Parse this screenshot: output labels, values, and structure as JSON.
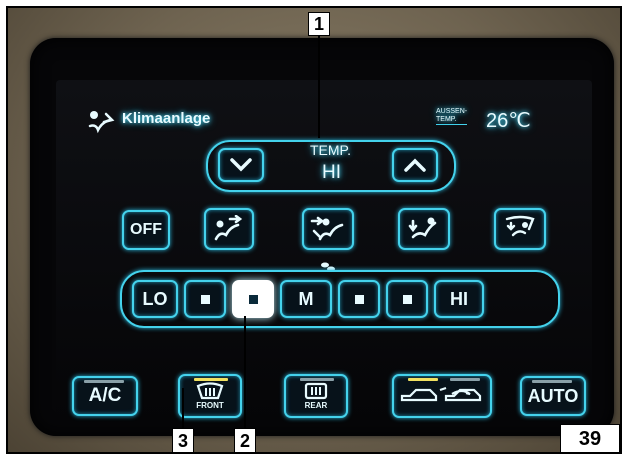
{
  "header": {
    "title": "Klimaanlage",
    "outside_label": "AUSSEN-\nTEMP.",
    "outside_temp": "26℃"
  },
  "temp": {
    "label": "TEMP.",
    "value": "HI"
  },
  "mode_row": {
    "off_label": "OFF"
  },
  "fan": {
    "labels": [
      "LO",
      "",
      "",
      "M",
      "",
      "",
      "HI"
    ],
    "active_level": 3,
    "levels": 7
  },
  "bottom": {
    "ac_label": "A/C",
    "front_label": "FRONT",
    "rear_label": "REAR",
    "auto_label": "AUTO"
  },
  "callouts": {
    "c1": "1",
    "c2": "2",
    "c3": "3"
  },
  "page_number": "39",
  "colors": {
    "glow": "#44d2ec",
    "indicator_yellow": "#f0e060",
    "indicator_off": "#8aa0a8"
  }
}
